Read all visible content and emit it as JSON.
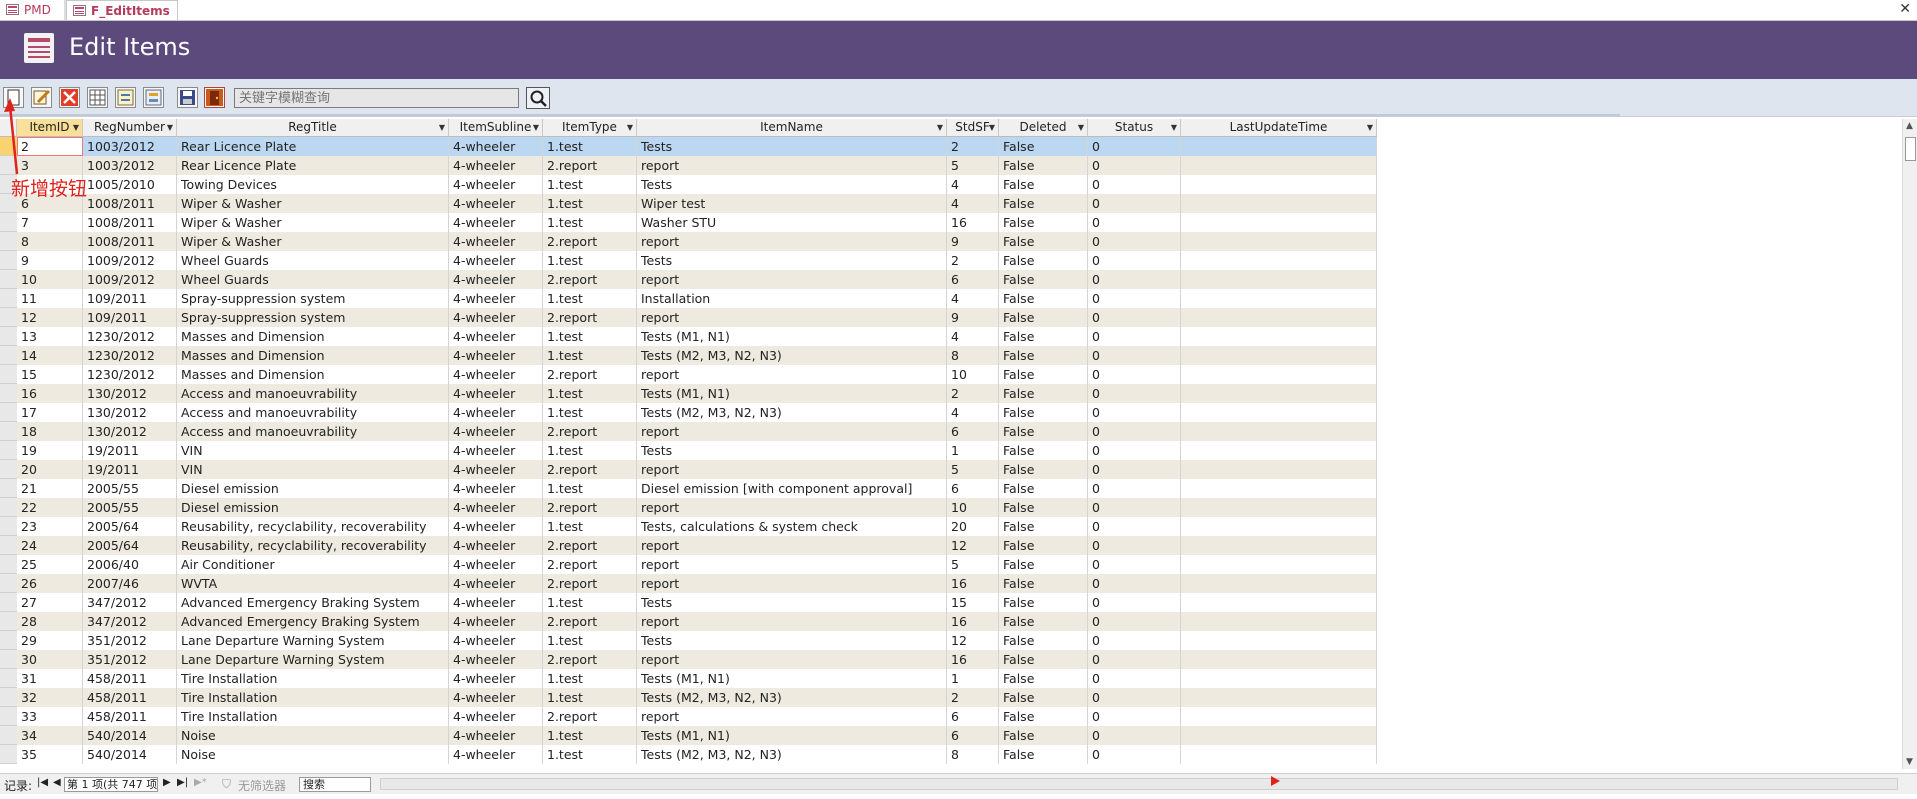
{
  "tabs": [
    {
      "label": "PMD"
    },
    {
      "label": "F_EditItems"
    }
  ],
  "header": {
    "title": "Edit Items"
  },
  "toolbar": {
    "buttons": [
      "new-record-icon",
      "edit-record-icon",
      "delete-record-icon",
      "datasheet-view-icon",
      "form-view-icon",
      "report-view-icon",
      "save-icon",
      "exit-door-icon"
    ],
    "search_placeholder": "关键字模糊查询"
  },
  "annotation": {
    "label": "新增按钮"
  },
  "columns": [
    {
      "label": "ItemID"
    },
    {
      "label": "RegNumber"
    },
    {
      "label": "RegTitle"
    },
    {
      "label": "ItemSubline"
    },
    {
      "label": "ItemType"
    },
    {
      "label": "ItemName"
    },
    {
      "label": "StdSF"
    },
    {
      "label": "Deleted"
    },
    {
      "label": "Status"
    },
    {
      "label": "LastUpdateTime"
    }
  ],
  "rows": [
    {
      "ItemID": "2",
      "RegNumber": "1003/2012",
      "RegTitle": "Rear Licence Plate",
      "ItemSubline": "4-wheeler",
      "ItemType": "1.test",
      "ItemName": "Tests",
      "StdSF": "2",
      "Deleted": "False",
      "Status": "0",
      "LastUpdateTime": ""
    },
    {
      "ItemID": "3",
      "RegNumber": "1003/2012",
      "RegTitle": "Rear Licence Plate",
      "ItemSubline": "4-wheeler",
      "ItemType": "2.report",
      "ItemName": "report",
      "StdSF": "5",
      "Deleted": "False",
      "Status": "0",
      "LastUpdateTime": ""
    },
    {
      "ItemID": "",
      "RegNumber": "1005/2010",
      "RegTitle": "Towing Devices",
      "ItemSubline": "4-wheeler",
      "ItemType": "1.test",
      "ItemName": "Tests",
      "StdSF": "4",
      "Deleted": "False",
      "Status": "0",
      "LastUpdateTime": ""
    },
    {
      "ItemID": "6",
      "RegNumber": "1008/2011",
      "RegTitle": "Wiper & Washer",
      "ItemSubline": "4-wheeler",
      "ItemType": "1.test",
      "ItemName": "Wiper test",
      "StdSF": "4",
      "Deleted": "False",
      "Status": "0",
      "LastUpdateTime": ""
    },
    {
      "ItemID": "7",
      "RegNumber": "1008/2011",
      "RegTitle": "Wiper & Washer",
      "ItemSubline": "4-wheeler",
      "ItemType": "1.test",
      "ItemName": "Washer STU",
      "StdSF": "16",
      "Deleted": "False",
      "Status": "0",
      "LastUpdateTime": ""
    },
    {
      "ItemID": "8",
      "RegNumber": "1008/2011",
      "RegTitle": "Wiper & Washer",
      "ItemSubline": "4-wheeler",
      "ItemType": "2.report",
      "ItemName": "report",
      "StdSF": "9",
      "Deleted": "False",
      "Status": "0",
      "LastUpdateTime": ""
    },
    {
      "ItemID": "9",
      "RegNumber": "1009/2012",
      "RegTitle": "Wheel Guards",
      "ItemSubline": "4-wheeler",
      "ItemType": "1.test",
      "ItemName": "Tests",
      "StdSF": "2",
      "Deleted": "False",
      "Status": "0",
      "LastUpdateTime": ""
    },
    {
      "ItemID": "10",
      "RegNumber": "1009/2012",
      "RegTitle": "Wheel Guards",
      "ItemSubline": "4-wheeler",
      "ItemType": "2.report",
      "ItemName": "report",
      "StdSF": "6",
      "Deleted": "False",
      "Status": "0",
      "LastUpdateTime": ""
    },
    {
      "ItemID": "11",
      "RegNumber": "109/2011",
      "RegTitle": "Spray-suppression system",
      "ItemSubline": "4-wheeler",
      "ItemType": "1.test",
      "ItemName": "Installation",
      "StdSF": "4",
      "Deleted": "False",
      "Status": "0",
      "LastUpdateTime": ""
    },
    {
      "ItemID": "12",
      "RegNumber": "109/2011",
      "RegTitle": "Spray-suppression system",
      "ItemSubline": "4-wheeler",
      "ItemType": "2.report",
      "ItemName": "report",
      "StdSF": "9",
      "Deleted": "False",
      "Status": "0",
      "LastUpdateTime": ""
    },
    {
      "ItemID": "13",
      "RegNumber": "1230/2012",
      "RegTitle": "Masses and Dimension",
      "ItemSubline": "4-wheeler",
      "ItemType": "1.test",
      "ItemName": "Tests (M1, N1)",
      "StdSF": "4",
      "Deleted": "False",
      "Status": "0",
      "LastUpdateTime": ""
    },
    {
      "ItemID": "14",
      "RegNumber": "1230/2012",
      "RegTitle": "Masses and Dimension",
      "ItemSubline": "4-wheeler",
      "ItemType": "1.test",
      "ItemName": "Tests (M2, M3, N2, N3)",
      "StdSF": "8",
      "Deleted": "False",
      "Status": "0",
      "LastUpdateTime": ""
    },
    {
      "ItemID": "15",
      "RegNumber": "1230/2012",
      "RegTitle": "Masses and Dimension",
      "ItemSubline": "4-wheeler",
      "ItemType": "2.report",
      "ItemName": "report",
      "StdSF": "10",
      "Deleted": "False",
      "Status": "0",
      "LastUpdateTime": ""
    },
    {
      "ItemID": "16",
      "RegNumber": "130/2012",
      "RegTitle": "Access and manoeuvrability",
      "ItemSubline": "4-wheeler",
      "ItemType": "1.test",
      "ItemName": "Tests (M1, N1)",
      "StdSF": "2",
      "Deleted": "False",
      "Status": "0",
      "LastUpdateTime": ""
    },
    {
      "ItemID": "17",
      "RegNumber": "130/2012",
      "RegTitle": "Access and manoeuvrability",
      "ItemSubline": "4-wheeler",
      "ItemType": "1.test",
      "ItemName": "Tests (M2, M3, N2, N3)",
      "StdSF": "4",
      "Deleted": "False",
      "Status": "0",
      "LastUpdateTime": ""
    },
    {
      "ItemID": "18",
      "RegNumber": "130/2012",
      "RegTitle": "Access and manoeuvrability",
      "ItemSubline": "4-wheeler",
      "ItemType": "2.report",
      "ItemName": "report",
      "StdSF": "6",
      "Deleted": "False",
      "Status": "0",
      "LastUpdateTime": ""
    },
    {
      "ItemID": "19",
      "RegNumber": "19/2011",
      "RegTitle": "VIN",
      "ItemSubline": "4-wheeler",
      "ItemType": "1.test",
      "ItemName": "Tests",
      "StdSF": "1",
      "Deleted": "False",
      "Status": "0",
      "LastUpdateTime": ""
    },
    {
      "ItemID": "20",
      "RegNumber": "19/2011",
      "RegTitle": "VIN",
      "ItemSubline": "4-wheeler",
      "ItemType": "2.report",
      "ItemName": "report",
      "StdSF": "5",
      "Deleted": "False",
      "Status": "0",
      "LastUpdateTime": ""
    },
    {
      "ItemID": "21",
      "RegNumber": "2005/55",
      "RegTitle": "Diesel emission",
      "ItemSubline": "4-wheeler",
      "ItemType": "1.test",
      "ItemName": "Diesel emission [with component approval]",
      "StdSF": "6",
      "Deleted": "False",
      "Status": "0",
      "LastUpdateTime": ""
    },
    {
      "ItemID": "22",
      "RegNumber": "2005/55",
      "RegTitle": "Diesel emission",
      "ItemSubline": "4-wheeler",
      "ItemType": "2.report",
      "ItemName": "report",
      "StdSF": "10",
      "Deleted": "False",
      "Status": "0",
      "LastUpdateTime": ""
    },
    {
      "ItemID": "23",
      "RegNumber": "2005/64",
      "RegTitle": "Reusability, recyclability, recoverability",
      "ItemSubline": "4-wheeler",
      "ItemType": "1.test",
      "ItemName": "Tests, calculations & system check",
      "StdSF": "20",
      "Deleted": "False",
      "Status": "0",
      "LastUpdateTime": ""
    },
    {
      "ItemID": "24",
      "RegNumber": "2005/64",
      "RegTitle": "Reusability, recyclability, recoverability",
      "ItemSubline": "4-wheeler",
      "ItemType": "2.report",
      "ItemName": "report",
      "StdSF": "12",
      "Deleted": "False",
      "Status": "0",
      "LastUpdateTime": ""
    },
    {
      "ItemID": "25",
      "RegNumber": "2006/40",
      "RegTitle": "Air Conditioner",
      "ItemSubline": "4-wheeler",
      "ItemType": "2.report",
      "ItemName": "report",
      "StdSF": "5",
      "Deleted": "False",
      "Status": "0",
      "LastUpdateTime": ""
    },
    {
      "ItemID": "26",
      "RegNumber": "2007/46",
      "RegTitle": "WVTA",
      "ItemSubline": "4-wheeler",
      "ItemType": "2.report",
      "ItemName": "report",
      "StdSF": "16",
      "Deleted": "False",
      "Status": "0",
      "LastUpdateTime": ""
    },
    {
      "ItemID": "27",
      "RegNumber": "347/2012",
      "RegTitle": "Advanced Emergency Braking System",
      "ItemSubline": "4-wheeler",
      "ItemType": "1.test",
      "ItemName": "Tests",
      "StdSF": "15",
      "Deleted": "False",
      "Status": "0",
      "LastUpdateTime": ""
    },
    {
      "ItemID": "28",
      "RegNumber": "347/2012",
      "RegTitle": "Advanced Emergency Braking System",
      "ItemSubline": "4-wheeler",
      "ItemType": "2.report",
      "ItemName": "report",
      "StdSF": "16",
      "Deleted": "False",
      "Status": "0",
      "LastUpdateTime": ""
    },
    {
      "ItemID": "29",
      "RegNumber": "351/2012",
      "RegTitle": "Lane Departure Warning System",
      "ItemSubline": "4-wheeler",
      "ItemType": "1.test",
      "ItemName": "Tests",
      "StdSF": "12",
      "Deleted": "False",
      "Status": "0",
      "LastUpdateTime": ""
    },
    {
      "ItemID": "30",
      "RegNumber": "351/2012",
      "RegTitle": "Lane Departure Warning System",
      "ItemSubline": "4-wheeler",
      "ItemType": "2.report",
      "ItemName": "report",
      "StdSF": "16",
      "Deleted": "False",
      "Status": "0",
      "LastUpdateTime": ""
    },
    {
      "ItemID": "31",
      "RegNumber": "458/2011",
      "RegTitle": "Tire Installation",
      "ItemSubline": "4-wheeler",
      "ItemType": "1.test",
      "ItemName": "Tests (M1, N1)",
      "StdSF": "1",
      "Deleted": "False",
      "Status": "0",
      "LastUpdateTime": ""
    },
    {
      "ItemID": "32",
      "RegNumber": "458/2011",
      "RegTitle": "Tire Installation",
      "ItemSubline": "4-wheeler",
      "ItemType": "1.test",
      "ItemName": "Tests (M2, M3, N2, N3)",
      "StdSF": "2",
      "Deleted": "False",
      "Status": "0",
      "LastUpdateTime": ""
    },
    {
      "ItemID": "33",
      "RegNumber": "458/2011",
      "RegTitle": "Tire Installation",
      "ItemSubline": "4-wheeler",
      "ItemType": "2.report",
      "ItemName": "report",
      "StdSF": "6",
      "Deleted": "False",
      "Status": "0",
      "LastUpdateTime": ""
    },
    {
      "ItemID": "34",
      "RegNumber": "540/2014",
      "RegTitle": "Noise",
      "ItemSubline": "4-wheeler",
      "ItemType": "1.test",
      "ItemName": "Tests (M1, N1)",
      "StdSF": "6",
      "Deleted": "False",
      "Status": "0",
      "LastUpdateTime": ""
    },
    {
      "ItemID": "35",
      "RegNumber": "540/2014",
      "RegTitle": "Noise",
      "ItemSubline": "4-wheeler",
      "ItemType": "1.test",
      "ItemName": "Tests (M2, M3, N2, N3)",
      "StdSF": "8",
      "Deleted": "False",
      "Status": "0",
      "LastUpdateTime": ""
    }
  ],
  "nav": {
    "record_label": "记录:",
    "record_value": "第 1 项(共 747 项",
    "filter_label": "无筛选器",
    "search_label": "搜索"
  },
  "colors": {
    "header_bg": "#5c4a7d",
    "selected_row": "#bcd7f1",
    "alt_row": "#eeeae0",
    "annotation": "#e0221c"
  }
}
